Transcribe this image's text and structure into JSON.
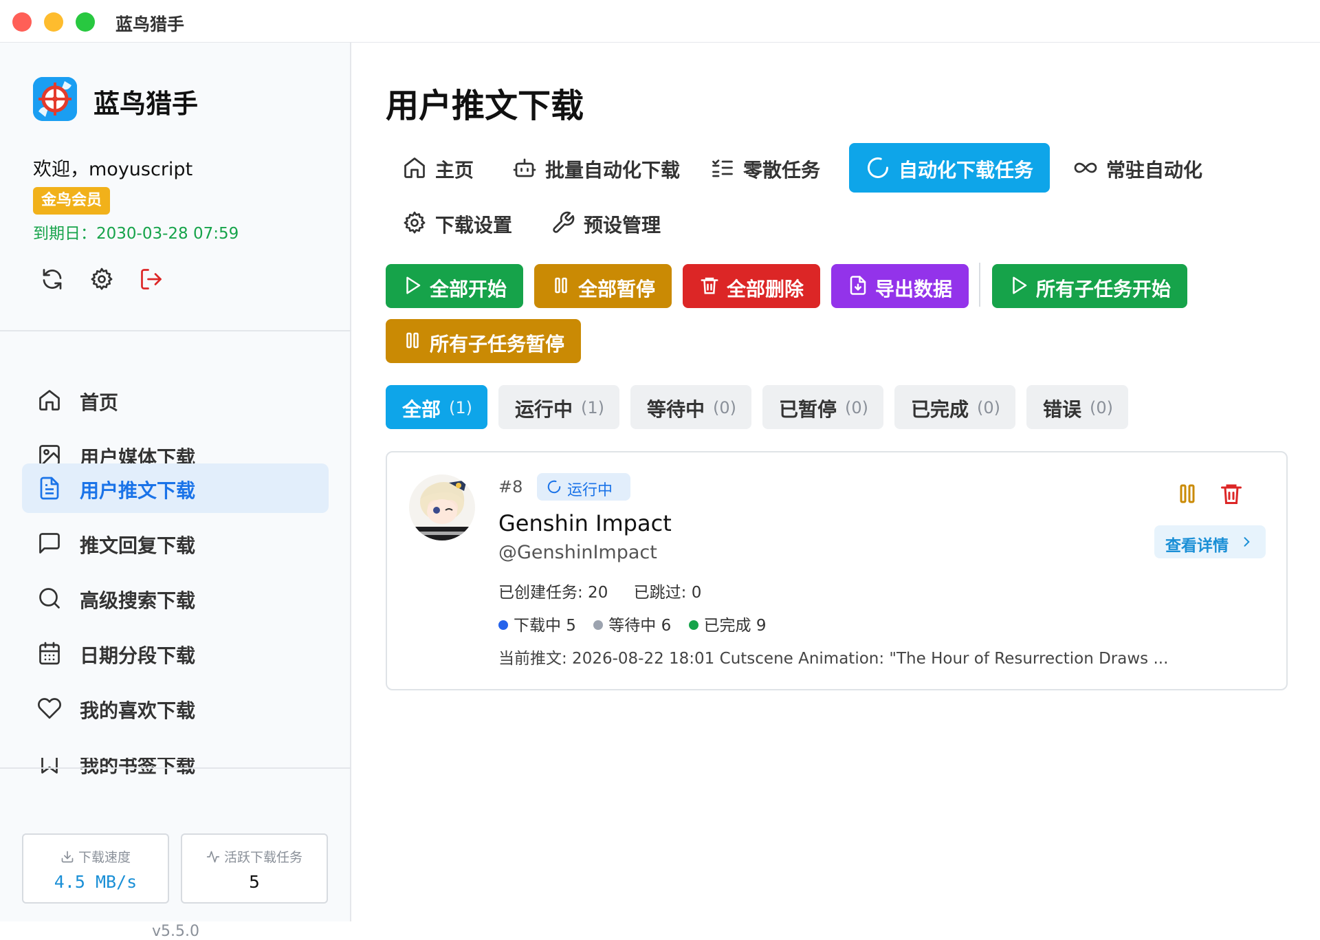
{
  "window": {
    "title": "蓝鸟猎手"
  },
  "sidebar": {
    "brand_name": "蓝鸟猎手",
    "welcome": "欢迎，moyuscript",
    "member_badge": "金鸟会员",
    "expire": "到期日：2030-03-28 07:59",
    "tools": [
      "refresh-icon",
      "gear-icon",
      "logout-icon"
    ],
    "nav": [
      {
        "label": "首页",
        "icon": "home-icon",
        "active": false
      },
      {
        "label": "用户媒体下载",
        "icon": "image-icon",
        "active": false
      },
      {
        "label": "用户推文下载",
        "icon": "document-icon",
        "active": true
      },
      {
        "label": "推文回复下载",
        "icon": "message-icon",
        "active": false
      },
      {
        "label": "高级搜索下载",
        "icon": "search-icon",
        "active": false
      },
      {
        "label": "日期分段下载",
        "icon": "calendar-icon",
        "active": false
      },
      {
        "label": "我的喜欢下载",
        "icon": "heart-icon",
        "active": false
      },
      {
        "label": "我的书签下载",
        "icon": "bookmark-icon",
        "active": false
      }
    ],
    "stats": {
      "speed_label": "下载速度",
      "speed_value": "4.5 MB/s",
      "active_label": "活跃下载任务",
      "active_value": "5"
    },
    "version": "v5.5.0"
  },
  "main": {
    "title": "用户推文下载",
    "tabs": [
      {
        "label": "主页",
        "icon": "home-icon",
        "active": false
      },
      {
        "label": "批量自动化下载",
        "icon": "bot-icon",
        "active": false
      },
      {
        "label": "零散任务",
        "icon": "list-checks-icon",
        "active": false
      },
      {
        "label": "自动化下载任务",
        "icon": "loader-icon",
        "active": true
      },
      {
        "label": "常驻自动化",
        "icon": "infinity-icon",
        "active": false
      },
      {
        "label": "下载设置",
        "icon": "gear-icon",
        "active": false
      },
      {
        "label": "预设管理",
        "icon": "wrench-icon",
        "active": false
      }
    ],
    "actions": [
      {
        "label": "全部开始",
        "icon": "play-icon",
        "color": "#16a34a"
      },
      {
        "label": "全部暂停",
        "icon": "pause-icon",
        "color": "#ca8a04"
      },
      {
        "label": "全部删除",
        "icon": "trash-icon",
        "color": "#dc2626"
      },
      {
        "label": "导出数据",
        "icon": "file-download-icon",
        "color": "#9333ea"
      },
      {
        "label": "所有子任务开始",
        "icon": "play-icon",
        "color": "#16a34a"
      },
      {
        "label": "所有子任务暂停",
        "icon": "pause-icon",
        "color": "#ca8a04"
      }
    ],
    "filters": [
      {
        "label": "全部",
        "count": "(1)",
        "active": true
      },
      {
        "label": "运行中",
        "count": "(1)",
        "active": false
      },
      {
        "label": "等待中",
        "count": "(0)",
        "active": false
      },
      {
        "label": "已暂停",
        "count": "(0)",
        "active": false
      },
      {
        "label": "已完成",
        "count": "(0)",
        "active": false
      },
      {
        "label": "错误",
        "count": "(0)",
        "active": false
      }
    ],
    "task": {
      "id": "#8",
      "status": "运行中",
      "name": "Genshin Impact",
      "handle": "@GenshinImpact",
      "created": "已创建任务: 20",
      "skipped": "已跳过: 0",
      "downloading": "下载中 5",
      "waiting": "等待中 6",
      "completed": "已完成 9",
      "current": "当前推文: 2026-08-22 18:01 Cutscene Animation: \"The Hour of Resurrection Draws ...",
      "detail_label": "查看详情",
      "colors": {
        "downloading": "#2563eb",
        "waiting": "#9ca3af",
        "completed": "#16a34a"
      }
    }
  }
}
